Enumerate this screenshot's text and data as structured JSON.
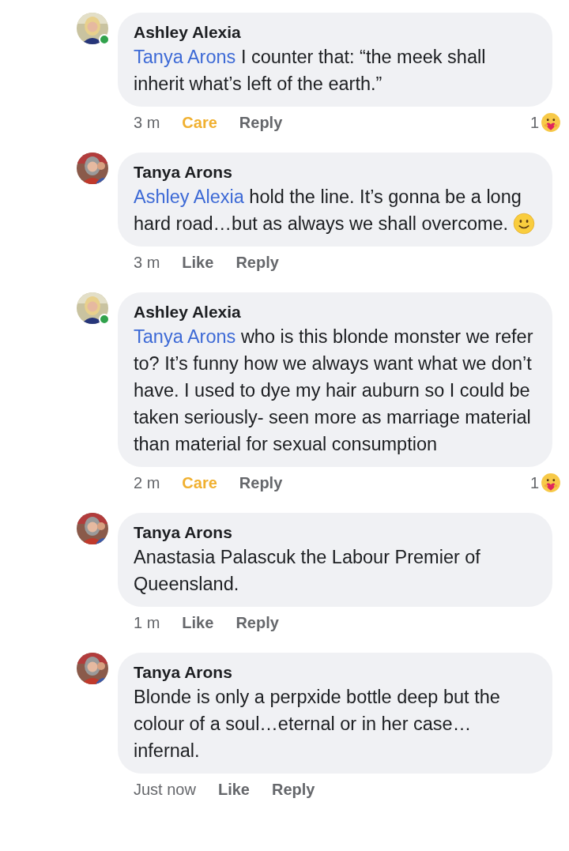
{
  "comments": [
    {
      "author": "Ashley Alexia",
      "online": true,
      "mention": "Tanya Arons",
      "text": "I counter that: “the meek shall inherit what’s left of the earth.”",
      "time": "3 m",
      "action": {
        "kind": "care",
        "label": "Care"
      },
      "reply": "Reply",
      "reaction": {
        "count": "1"
      }
    },
    {
      "author": "Tanya Arons",
      "online": false,
      "mention": "Ashley Alexia",
      "text": "hold the line.  It’s gonna be a long hard road…but as always we shall overcome.",
      "smiley": true,
      "time": "3 m",
      "action": {
        "kind": "like",
        "label": "Like"
      },
      "reply": "Reply"
    },
    {
      "author": "Ashley Alexia",
      "online": true,
      "mention": "Tanya Arons",
      "text": "who is this blonde monster we refer to? It’s funny how we always want what we don’t have. I used to dye my hair auburn so I could be taken seriously- seen more as marriage material than material for sexual consumption",
      "time": "2 m",
      "action": {
        "kind": "care",
        "label": "Care"
      },
      "reply": "Reply",
      "reaction": {
        "count": "1"
      }
    },
    {
      "author": "Tanya Arons",
      "online": false,
      "text": "Anastasia Palascuk the Labour Premier of Queensland.",
      "time": "1 m",
      "action": {
        "kind": "like",
        "label": "Like"
      },
      "reply": "Reply"
    },
    {
      "author": "Tanya Arons",
      "online": false,
      "text": "Blonde is only a perpxide bottle deep but the colour of a soul…eternal or in her case…infernal.",
      "time": "Just now",
      "action": {
        "kind": "like",
        "label": "Like"
      },
      "reply": "Reply"
    }
  ]
}
